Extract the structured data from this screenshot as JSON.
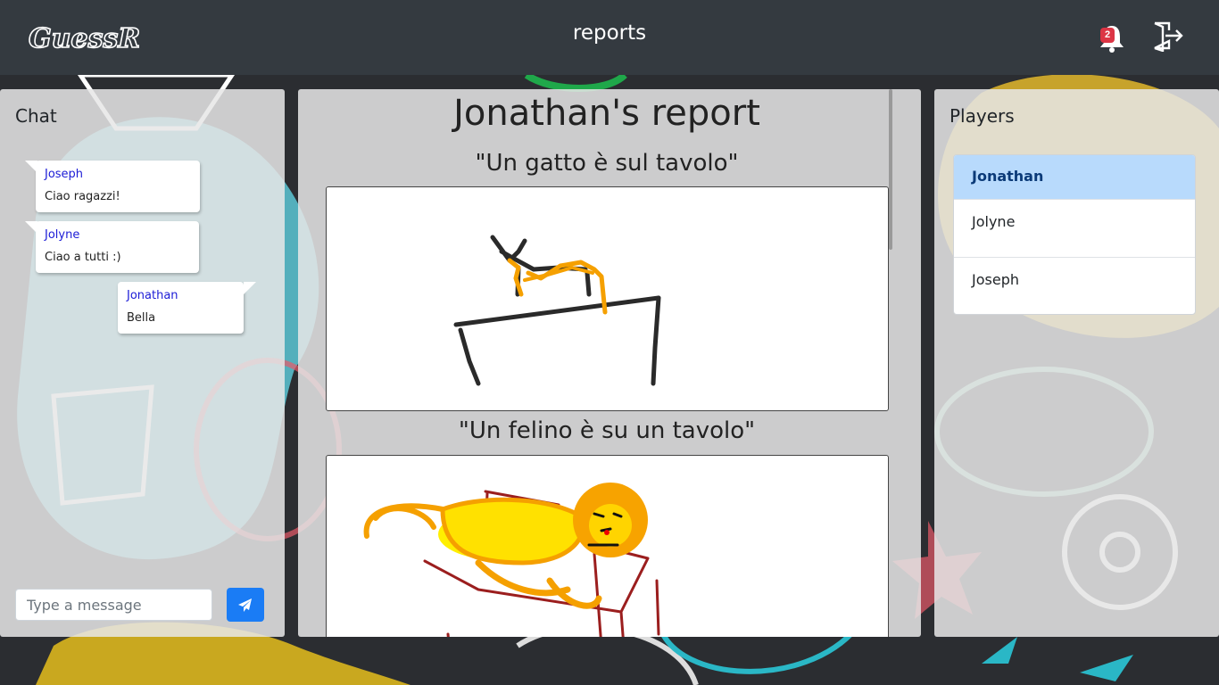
{
  "app": {
    "logo_text": "GuessR",
    "page_title": "reports"
  },
  "header": {
    "notification_icon": "bell-icon",
    "notification_count": "2",
    "logout_icon": "logout-icon"
  },
  "chat": {
    "heading": "Chat",
    "messages": [
      {
        "author": "Joseph",
        "text": "Ciao ragazzi!"
      },
      {
        "author": "Jolyne",
        "text": "Ciao a tutti :)"
      },
      {
        "author": "Jonathan",
        "text": "Bella"
      }
    ],
    "input_placeholder": "Type a message",
    "send_icon": "paper-plane-icon"
  },
  "report": {
    "title": "Jonathan's report",
    "entries": [
      {
        "caption": "\"Un gatto è sul tavolo\"",
        "drawing": "cat-on-table-drawing"
      },
      {
        "caption": "\"Un felino è su un tavolo\"",
        "drawing": "lion-on-table-drawing"
      }
    ]
  },
  "players": {
    "heading": "Players",
    "list": [
      "Jonathan",
      "Jolyne",
      "Joseph"
    ],
    "active": "Jonathan"
  },
  "colors": {
    "navbar": "#343a40",
    "accent": "#1a7cf5",
    "badge": "#dc3545",
    "active_player": "#b8dafc"
  }
}
